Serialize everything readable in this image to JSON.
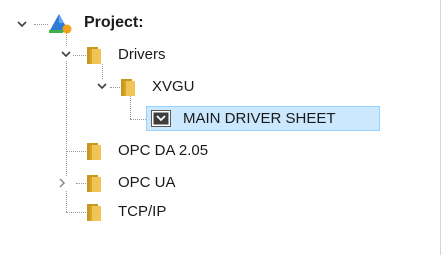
{
  "tree": {
    "nodes": [
      {
        "id": "project",
        "label": "Project:",
        "icon": "project-icon",
        "expanded": true
      },
      {
        "id": "drivers",
        "label": "Drivers",
        "icon": "folder-icon",
        "expanded": true
      },
      {
        "id": "xvgu",
        "label": "XVGU",
        "icon": "folder-icon",
        "expanded": true
      },
      {
        "id": "main-driver-sheet",
        "label": "MAIN DRIVER SHEET",
        "icon": "sheet-icon",
        "selected": true
      },
      {
        "id": "opc-da",
        "label": "OPC DA 2.05",
        "icon": "folder-icon"
      },
      {
        "id": "opc-ua",
        "label": "OPC UA",
        "icon": "folder-icon",
        "expanded": false
      },
      {
        "id": "tcp-ip",
        "label": "TCP/IP",
        "icon": "folder-icon"
      }
    ]
  },
  "colors": {
    "selection": "#cce8ff",
    "selection_border": "#99d1ff",
    "folder": "#e8b845",
    "folder_dark": "#c99820",
    "tree_lines": "#9b9b9b"
  }
}
